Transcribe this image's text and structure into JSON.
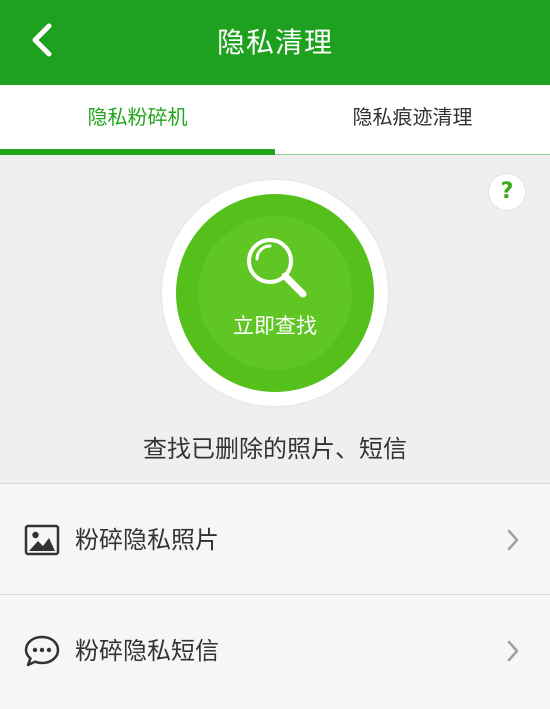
{
  "header": {
    "title": "隐私清理",
    "back_icon": "back-arrow-icon"
  },
  "tabs": [
    {
      "label": "隐私粉碎机",
      "active": true
    },
    {
      "label": "隐私痕迹清理",
      "active": false
    }
  ],
  "hero": {
    "help_label": "?",
    "button_label": "立即查找",
    "button_icon": "search-icon",
    "subtitle": "查找已删除的照片、短信"
  },
  "list": {
    "items": [
      {
        "label": "粉碎隐私照片",
        "icon": "image-icon"
      },
      {
        "label": "粉碎隐私短信",
        "icon": "message-icon"
      }
    ]
  },
  "colors": {
    "header_bg": "#1ea11e",
    "accent": "#22a51c",
    "button": "#55c01c"
  }
}
